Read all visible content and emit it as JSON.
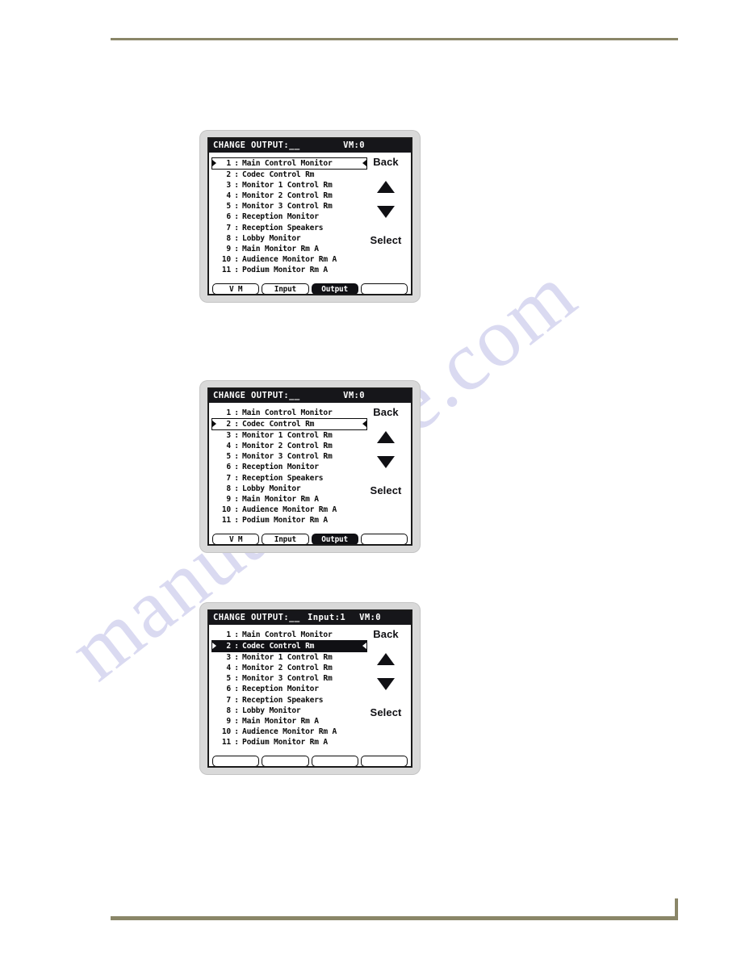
{
  "watermark": {
    "text": "manualshive.com"
  },
  "device_panels": [
    {
      "id": "panel-1",
      "titlebar": {
        "main": "CHANGE OUTPUT:__",
        "input": "",
        "vm": "VM:0"
      },
      "list": [
        {
          "index": "1",
          "sep": ":",
          "label": "Main Control Monitor",
          "state": "selected-outline"
        },
        {
          "index": "2",
          "sep": ":",
          "label": "Codec Control Rm",
          "state": "normal"
        },
        {
          "index": "3",
          "sep": ":",
          "label": "Monitor 1 Control Rm",
          "state": "normal"
        },
        {
          "index": "4",
          "sep": ":",
          "label": "Monitor 2 Control Rm",
          "state": "normal"
        },
        {
          "index": "5",
          "sep": ":",
          "label": "Monitor 3 Control Rm",
          "state": "normal"
        },
        {
          "index": "6",
          "sep": ":",
          "label": "Reception Monitor",
          "state": "normal"
        },
        {
          "index": "7",
          "sep": ":",
          "label": "Reception Speakers",
          "state": "normal"
        },
        {
          "index": "8",
          "sep": ":",
          "label": "Lobby Monitor",
          "state": "normal"
        },
        {
          "index": "9",
          "sep": ":",
          "label": "Main Monitor Rm A",
          "state": "normal"
        },
        {
          "index": "10",
          "sep": ":",
          "label": "Audience Monitor Rm A",
          "state": "normal"
        },
        {
          "index": "11",
          "sep": ":",
          "label": "Podium Monitor Rm A",
          "state": "normal"
        }
      ],
      "sidekeys": {
        "back": "Back",
        "up_icon": "triangle-up-icon",
        "down_icon": "triangle-down-icon",
        "select": "Select"
      },
      "buttons": [
        {
          "label": "V M",
          "active": false
        },
        {
          "label": "Input",
          "active": false
        },
        {
          "label": "Output",
          "active": true
        },
        {
          "label": "",
          "active": false
        }
      ]
    },
    {
      "id": "panel-2",
      "titlebar": {
        "main": "CHANGE OUTPUT:__",
        "input": "",
        "vm": "VM:0"
      },
      "list": [
        {
          "index": "1",
          "sep": ":",
          "label": "Main Control Monitor",
          "state": "normal"
        },
        {
          "index": "2",
          "sep": ":",
          "label": "Codec Control Rm",
          "state": "selected-outline"
        },
        {
          "index": "3",
          "sep": ":",
          "label": "Monitor 1 Control Rm",
          "state": "normal"
        },
        {
          "index": "4",
          "sep": ":",
          "label": "Monitor 2 Control Rm",
          "state": "normal"
        },
        {
          "index": "5",
          "sep": ":",
          "label": "Monitor 3 Control Rm",
          "state": "normal"
        },
        {
          "index": "6",
          "sep": ":",
          "label": "Reception Monitor",
          "state": "normal"
        },
        {
          "index": "7",
          "sep": ":",
          "label": "Reception Speakers",
          "state": "normal"
        },
        {
          "index": "8",
          "sep": ":",
          "label": "Lobby Monitor",
          "state": "normal"
        },
        {
          "index": "9",
          "sep": ":",
          "label": "Main Monitor Rm A",
          "state": "normal"
        },
        {
          "index": "10",
          "sep": ":",
          "label": "Audience Monitor Rm A",
          "state": "normal"
        },
        {
          "index": "11",
          "sep": ":",
          "label": "Podium Monitor Rm A",
          "state": "normal"
        }
      ],
      "sidekeys": {
        "back": "Back",
        "up_icon": "triangle-up-icon",
        "down_icon": "triangle-down-icon",
        "select": "Select"
      },
      "buttons": [
        {
          "label": "V M",
          "active": false
        },
        {
          "label": "Input",
          "active": false
        },
        {
          "label": "Output",
          "active": true
        },
        {
          "label": "",
          "active": false
        }
      ]
    },
    {
      "id": "panel-3",
      "titlebar": {
        "main": "CHANGE OUTPUT:__",
        "input": "Input:1",
        "vm": "VM:0"
      },
      "list": [
        {
          "index": "1",
          "sep": ":",
          "label": "Main Control Monitor",
          "state": "normal"
        },
        {
          "index": "2",
          "sep": ":",
          "label": "Codec Control Rm",
          "state": "selected-invert"
        },
        {
          "index": "3",
          "sep": ":",
          "label": "Monitor 1 Control Rm",
          "state": "normal"
        },
        {
          "index": "4",
          "sep": ":",
          "label": "Monitor 2 Control Rm",
          "state": "normal"
        },
        {
          "index": "5",
          "sep": ":",
          "label": "Monitor 3 Control Rm",
          "state": "normal"
        },
        {
          "index": "6",
          "sep": ":",
          "label": "Reception Monitor",
          "state": "normal"
        },
        {
          "index": "7",
          "sep": ":",
          "label": "Reception Speakers",
          "state": "normal"
        },
        {
          "index": "8",
          "sep": ":",
          "label": "Lobby Monitor",
          "state": "normal"
        },
        {
          "index": "9",
          "sep": ":",
          "label": "Main Monitor Rm A",
          "state": "normal"
        },
        {
          "index": "10",
          "sep": ":",
          "label": "Audience Monitor Rm A",
          "state": "normal"
        },
        {
          "index": "11",
          "sep": ":",
          "label": "Podium Monitor Rm A",
          "state": "normal"
        }
      ],
      "sidekeys": {
        "back": "Back",
        "up_icon": "triangle-up-icon",
        "down_icon": "triangle-down-icon",
        "select": "Select"
      },
      "buttons": [
        {
          "label": "",
          "active": false
        },
        {
          "label": "",
          "active": false
        },
        {
          "label": "",
          "active": false
        },
        {
          "label": "",
          "active": false
        }
      ]
    }
  ],
  "colors": {
    "rule": "#8a8668",
    "lcd_background": "#ffffff",
    "lcd_foreground": "#101014",
    "bezel": "#d9d9d9",
    "watermark": "#cdcdec"
  }
}
